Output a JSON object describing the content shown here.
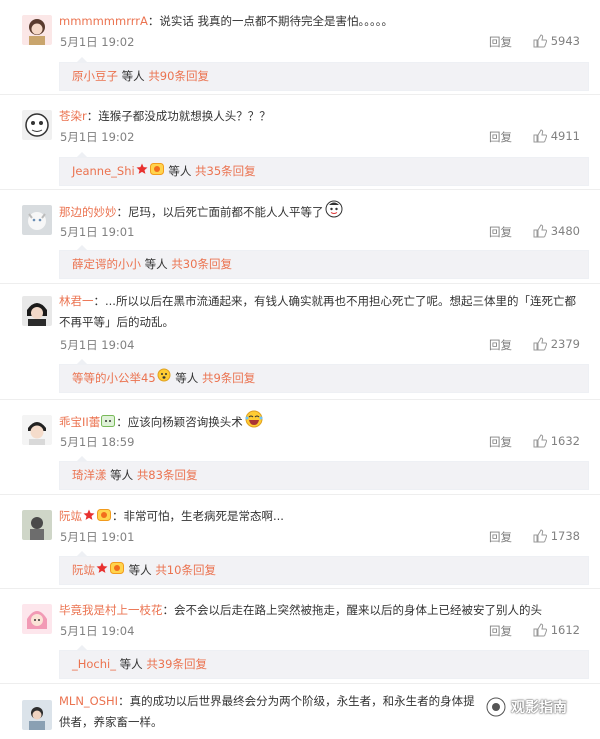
{
  "comments": [
    {
      "username": "mmmmmmrrrA",
      "text": "：说实话 我真的一点都不期待完全是害怕。。。。。",
      "date": "5月1日 19:02",
      "reply": "回复",
      "likes": "5943",
      "sub": {
        "name": "原小豆子",
        "mid": " 等人 ",
        "count": "共90条回复"
      }
    },
    {
      "username": "苍染r",
      "text": "：连猴子都没成功就想换人头？？？",
      "date": "5月1日 19:02",
      "reply": "回复",
      "likes": "4911",
      "sub": {
        "name": "Jeanne_Shi",
        "mid": " 等人 ",
        "count": "共35条回复"
      }
    },
    {
      "username": "那边的妙妙",
      "text": "：尼玛，以后死亡面前都不能人人平等了",
      "date": "5月1日 19:01",
      "reply": "回复",
      "likes": "3480",
      "sub": {
        "name": "薛定谔的小小",
        "mid": " 等人 ",
        "count": "共30条回复"
      }
    },
    {
      "username": "林君一",
      "text": "：...所以以后在黑市流通起来，有钱人确实就再也不用担心死亡了呢。想起三体里的「连死亡都不再平等」后的动乱。",
      "date": "5月1日 19:04",
      "reply": "回复",
      "likes": "2379",
      "sub": {
        "name": "等等的小公举45",
        "mid": " 等人 ",
        "count": "共9条回复"
      }
    },
    {
      "username": "乖宝II蕾",
      "text": "：应该向杨颖咨询换头术",
      "date": "5月1日 18:59",
      "reply": "回复",
      "likes": "1632",
      "sub": {
        "name": "琦洋漾",
        "mid": " 等人 ",
        "count": "共83条回复"
      }
    },
    {
      "username": "阮竑",
      "text": "：非常可怕，生老病死是常态啊...",
      "date": "5月1日 19:01",
      "reply": "回复",
      "likes": "1738",
      "sub": {
        "name": "阮竑",
        "mid": " 等人 ",
        "count": "共10条回复"
      }
    },
    {
      "username": "毕竟我是村上一枝花",
      "text": "：会不会以后走在路上突然被拖走，醒来以后的身体上已经被安了别人的头",
      "date": "5月1日 19:04",
      "reply": "回复",
      "likes": "1612",
      "sub": {
        "name": "_Hochi_",
        "mid": " 等人 ",
        "count": "共39条回复"
      }
    },
    {
      "username": "MLN_OSHI",
      "text": "：真的成功以后世界最终会分为两个阶级，永生者，和永生者的身体提供者，养家畜一样。",
      "date": "",
      "reply": "",
      "likes": "",
      "sub": null
    }
  ],
  "watermark": "观影指南",
  "colors": {
    "username": "#eb7350",
    "meta": "#808080",
    "sub_bg": "#f2f2f5"
  }
}
